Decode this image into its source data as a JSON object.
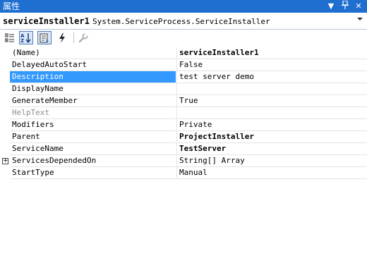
{
  "window": {
    "title": "属性",
    "buttons": [
      "▼",
      "♯",
      "✕"
    ]
  },
  "object_selector": {
    "name": "serviceInstaller1",
    "type": "System.ServiceProcess.ServiceInstaller"
  },
  "toolbar": {
    "buttons": [
      {
        "icon": "categorized-icon",
        "active": false
      },
      {
        "icon": "alphabetical-sort-icon",
        "active": true
      },
      {
        "icon": "properties-icon",
        "active": true
      },
      {
        "icon": "events-lightning-icon",
        "active": false
      },
      {
        "icon": "property-pages-wrench-icon",
        "active": false
      }
    ]
  },
  "properties": [
    {
      "name": "(Name)",
      "value": "serviceInstaller1",
      "bold": true
    },
    {
      "name": "DelayedAutoStart",
      "value": "False"
    },
    {
      "name": "Description",
      "value": "test server demo",
      "selected": true
    },
    {
      "name": "DisplayName",
      "value": ""
    },
    {
      "name": "GenerateMember",
      "value": "True"
    },
    {
      "name": "HelpText",
      "value": "",
      "gray": true
    },
    {
      "name": "Modifiers",
      "value": "Private"
    },
    {
      "name": "Parent",
      "value": "ProjectInstaller",
      "bold": true
    },
    {
      "name": "ServiceName",
      "value": "TestServer",
      "bold": true
    },
    {
      "name": "ServicesDependedOn",
      "value": "String[] Array",
      "expandable": true
    },
    {
      "name": "StartType",
      "value": "Manual"
    }
  ]
}
